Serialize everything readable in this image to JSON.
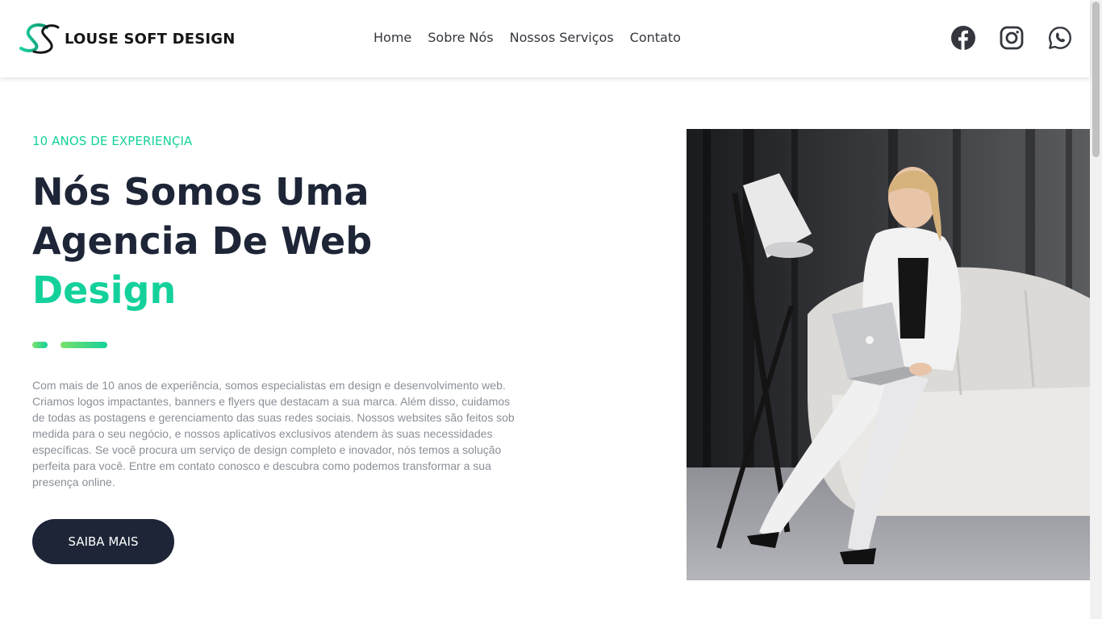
{
  "brand": {
    "name": "LOUSE SOFT DESIGN",
    "accent_color": "#14d19c",
    "dark_color": "#1d2537"
  },
  "nav": {
    "items": [
      {
        "label": "Home"
      },
      {
        "label": "Sobre Nós"
      },
      {
        "label": "Nossos Serviços"
      },
      {
        "label": "Contato"
      }
    ]
  },
  "socials": [
    {
      "icon": "facebook-icon"
    },
    {
      "icon": "instagram-icon"
    },
    {
      "icon": "whatsapp-icon"
    }
  ],
  "hero": {
    "eyebrow": "10 ANOS DE EXPERIENÇIA",
    "headline_line1": "Nós Somos Uma",
    "headline_line2": "Agencia De Web",
    "headline_accent": "Design",
    "paragraph": "Com mais de 10 anos de experiência, somos especialistas em design e desenvolvimento web. Criamos logos impactantes, banners e flyers que destacam a sua marca. Além disso, cuidamos de todas as postagens e gerenciamento das suas redes sociais. Nossos websites são feitos sob medida para o seu negócio, e nossos aplicativos exclusivos atendem às suas necessidades específicas. Se você procura um serviço de design completo e inovador, nós temos a solução perfeita para você. Entre em contato conosco e descubra como podemos transformar a sua presença online.",
    "cta_label": "SAIBA MAIS",
    "image": "woman-with-laptop-on-white-armchair"
  }
}
